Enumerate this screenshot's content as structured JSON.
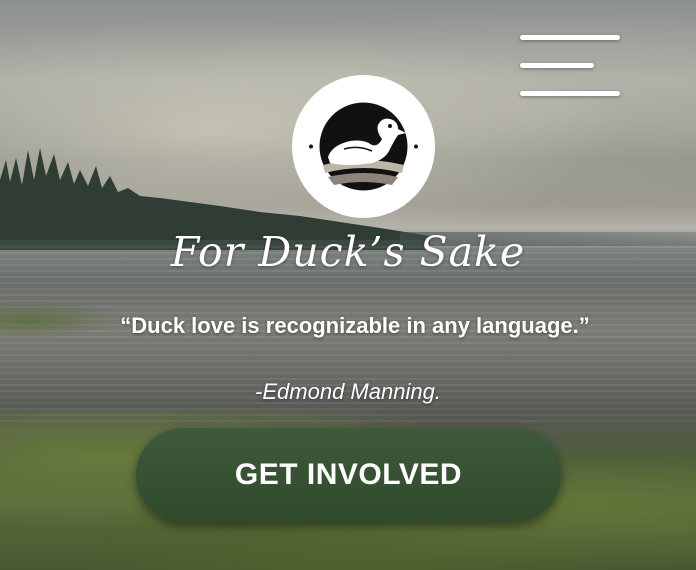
{
  "header": {
    "menu_icon": "hamburger-menu-icon",
    "logo_icon": "duck-logo-icon"
  },
  "hero": {
    "title": "For Duck’s Sake",
    "quote": "“Duck love is recognizable in any language.”",
    "author": "-Edmond Manning.",
    "cta_label": "GET INVOLVED"
  },
  "colors": {
    "button": "#3f5a3a",
    "text": "#ffffff",
    "logo_bg": "#ffffff",
    "logo_mark": "#111111"
  }
}
